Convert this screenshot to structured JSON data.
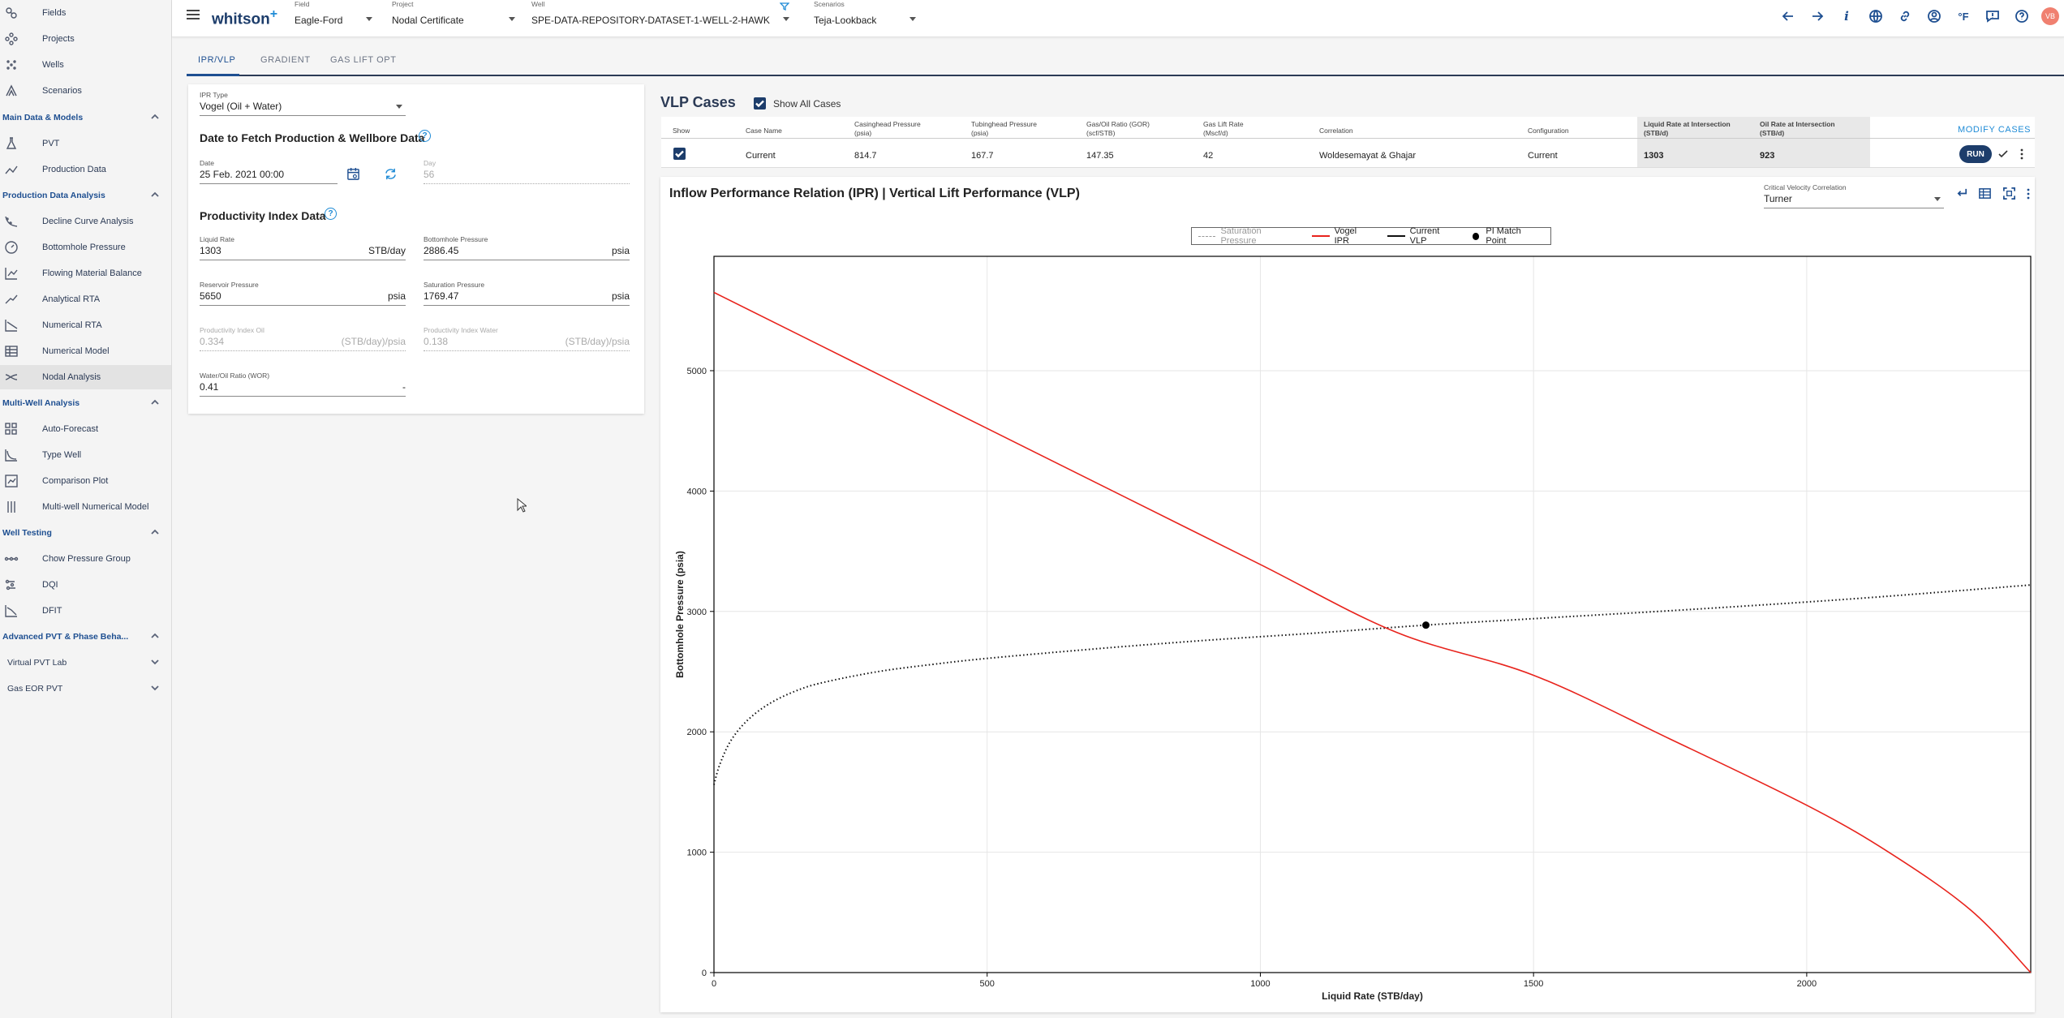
{
  "sidebar": {
    "items": [
      {
        "label": "Fields",
        "icon": "fields-icon"
      },
      {
        "label": "Projects",
        "icon": "projects-icon"
      },
      {
        "label": "Wells",
        "icon": "wells-icon"
      },
      {
        "label": "Scenarios",
        "icon": "scenarios-icon"
      }
    ],
    "sections": [
      {
        "label": "Main Data & Models",
        "items": [
          {
            "label": "PVT",
            "icon": "flask-icon"
          },
          {
            "label": "Production Data",
            "icon": "line-chart-icon"
          }
        ]
      },
      {
        "label": "Production Data Analysis",
        "items": [
          {
            "label": "Decline Curve Analysis",
            "icon": "decline-curve-icon"
          },
          {
            "label": "Bottomhole Pressure",
            "icon": "gauge-icon"
          },
          {
            "label": "Flowing Material Balance",
            "icon": "bar-chart-icon"
          },
          {
            "label": "Analytical RTA",
            "icon": "trend-icon"
          },
          {
            "label": "Numerical RTA",
            "icon": "numerical-rta-icon"
          },
          {
            "label": "Numerical Model",
            "icon": "grid-model-icon"
          },
          {
            "label": "Nodal Analysis",
            "icon": "nodal-icon"
          }
        ]
      },
      {
        "label": "Multi-Well Analysis",
        "items": [
          {
            "label": "Auto-Forecast",
            "icon": "tiles-icon"
          },
          {
            "label": "Type Well",
            "icon": "type-well-icon"
          },
          {
            "label": "Comparison Plot",
            "icon": "comparison-icon"
          },
          {
            "label": "Multi-well Numerical Model",
            "icon": "multi-well-icon"
          }
        ]
      },
      {
        "label": "Well Testing",
        "items": [
          {
            "label": "Chow Pressure Group",
            "icon": "chow-icon"
          },
          {
            "label": "DQI",
            "icon": "dqi-icon"
          },
          {
            "label": "DFIT",
            "icon": "dfit-icon"
          }
        ]
      },
      {
        "label": "Advanced PVT & Phase Beha...",
        "items": []
      }
    ],
    "collapsed": [
      "Virtual PVT Lab",
      "Gas EOR PVT"
    ],
    "active": "Nodal Analysis"
  },
  "topbar": {
    "logo": "whitson",
    "logo_plus": "+",
    "field": {
      "label": "Field",
      "value": "Eagle-Ford"
    },
    "project": {
      "label": "Project",
      "value": "Nodal Certificate"
    },
    "well": {
      "label": "Well",
      "value": "SPE-DATA-REPOSITORY-DATASET-1-WELL-2-HAWK"
    },
    "scenario": {
      "label": "Scenarios",
      "value": "Teja-Lookback"
    },
    "units_label": "°F",
    "avatar_initials": "VB"
  },
  "tabs": [
    "IPR/VLP",
    "GRADIENT",
    "GAS LIFT OPT"
  ],
  "ipr": {
    "type_label": "IPR Type",
    "type_value": "Vogel (Oil + Water)",
    "date_section_title": "Date to Fetch Production & Wellbore Data",
    "date_label": "Date",
    "date_value": "25 Feb. 2021 00:00",
    "day_label": "Day",
    "day_value": "56",
    "pi_section_title": "Productivity Index Data",
    "fields": {
      "liquid_rate": {
        "label": "Liquid Rate",
        "value": "1303",
        "unit": "STB/day"
      },
      "bhp": {
        "label": "Bottomhole Pressure",
        "value": "2886.45",
        "unit": "psia"
      },
      "reservoir_pressure": {
        "label": "Reservoir Pressure",
        "value": "5650",
        "unit": "psia"
      },
      "saturation_pressure": {
        "label": "Saturation Pressure",
        "value": "1769.47",
        "unit": "psia"
      },
      "pi_oil": {
        "label": "Productivity Index Oil",
        "value": "0.334",
        "unit": "(STB/day)/psia"
      },
      "pi_water": {
        "label": "Productivity Index Water",
        "value": "0.138",
        "unit": "(STB/day)/psia"
      },
      "wor": {
        "label": "Water/Oil Ratio (WOR)",
        "value": "0.41",
        "unit": "-"
      }
    }
  },
  "vlp": {
    "title": "VLP Cases",
    "show_all_label": "Show All Cases",
    "modify_label": "MODIFY CASES",
    "run_label": "RUN",
    "headers": {
      "show": "Show",
      "case_name": "Case Name",
      "casinghead": [
        "Casinghead Pressure",
        "(psia)"
      ],
      "tubinghead": [
        "Tubinghead Pressure",
        "(psia)"
      ],
      "gor": [
        "Gas/Oil Ratio (GOR)",
        "(scf/STB)"
      ],
      "gas_lift": [
        "Gas Lift Rate",
        "(Mscf/d)"
      ],
      "correlation": "Correlation",
      "configuration": "Configuration",
      "liq_int": [
        "Liquid Rate at Intersection",
        "(STB/d)"
      ],
      "oil_int": [
        "Oil Rate at Intersection",
        "(STB/d)"
      ]
    },
    "row": {
      "case_name": "Current",
      "casinghead": "814.7",
      "tubinghead": "167.7",
      "gor": "147.35",
      "gas_lift": "42",
      "correlation": "Woldesemayat & Ghajar",
      "configuration": "Current",
      "liq_int": "1303",
      "oil_int": "923"
    }
  },
  "chart": {
    "title": "Inflow Performance Relation (IPR) | Vertical Lift Performance (VLP)",
    "cv_label": "Critical Velocity Correlation",
    "cv_value": "Turner"
  },
  "chart_data": {
    "type": "line",
    "xlabel": "Liquid Rate (STB/day)",
    "ylabel": "Bottomhole Pressure (psia)",
    "xlim": [
      0,
      2410
    ],
    "ylim": [
      0,
      5950
    ],
    "xticks": [
      0,
      500,
      1000,
      1500,
      2000
    ],
    "yticks": [
      0,
      1000,
      2000,
      3000,
      4000,
      5000
    ],
    "grid": true,
    "legend_position": "top-center",
    "colors": {
      "ipr": "#e8231c",
      "vlp": "#111111",
      "sat": "#999999",
      "pi": "#000000"
    },
    "series": [
      {
        "name": "Saturation Pressure",
        "style": "dashed"
      },
      {
        "name": "Vogel IPR",
        "style": "solid",
        "x": [
          0,
          250,
          500,
          750,
          1000,
          1250,
          1303,
          1500,
          1750,
          2000,
          2150,
          2300,
          2410
        ],
        "y": [
          5650,
          5085,
          4520,
          3955,
          3390,
          2825,
          2886.45,
          2470,
          1940,
          1390,
          1000,
          520,
          0
        ]
      },
      {
        "name": "Current VLP",
        "style": "dotted",
        "x": [
          0,
          10,
          30,
          60,
          100,
          150,
          200,
          300,
          400,
          500,
          700,
          900,
          1100,
          1303,
          1500,
          1800,
          2100,
          2410
        ],
        "y": [
          1560,
          1720,
          1920,
          2090,
          2230,
          2340,
          2410,
          2500,
          2560,
          2610,
          2690,
          2760,
          2820,
          2886.45,
          2940,
          3020,
          3110,
          3220
        ]
      },
      {
        "name": "PI Match Point",
        "style": "marker",
        "x": [
          1303
        ],
        "y": [
          2886.45
        ]
      }
    ]
  }
}
